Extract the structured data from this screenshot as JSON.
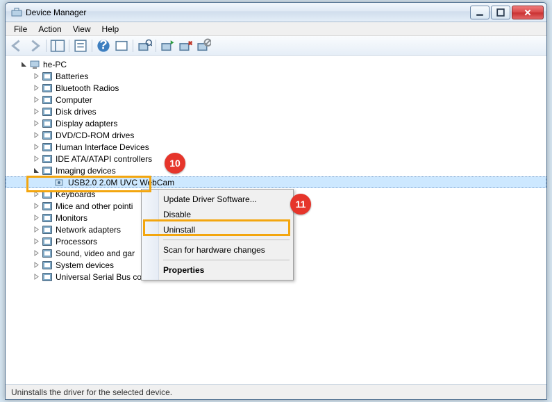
{
  "window": {
    "title": "Device Manager"
  },
  "menus": {
    "file": "File",
    "action": "Action",
    "view": "View",
    "help": "Help"
  },
  "tree": {
    "root": "he-PC",
    "categories": [
      {
        "label": "Batteries"
      },
      {
        "label": "Bluetooth Radios"
      },
      {
        "label": "Computer"
      },
      {
        "label": "Disk drives"
      },
      {
        "label": "Display adapters"
      },
      {
        "label": "DVD/CD-ROM drives"
      },
      {
        "label": "Human Interface Devices"
      },
      {
        "label": "IDE ATA/ATAPI controllers"
      },
      {
        "label": "Imaging devices",
        "expanded": true,
        "children": [
          {
            "label": "USB2.0 2.0M UVC WebCam",
            "selected": true
          }
        ]
      },
      {
        "label": "Keyboards"
      },
      {
        "label": "Mice and other pointi"
      },
      {
        "label": "Monitors"
      },
      {
        "label": "Network adapters"
      },
      {
        "label": "Processors"
      },
      {
        "label": "Sound, video and gar"
      },
      {
        "label": "System devices"
      },
      {
        "label": "Universal Serial Bus controllers"
      }
    ]
  },
  "context_menu": {
    "update": "Update Driver Software...",
    "disable": "Disable",
    "uninstall": "Uninstall",
    "scan": "Scan for hardware changes",
    "properties": "Properties"
  },
  "annotations": {
    "callout10": "10",
    "callout11": "11"
  },
  "statusbar": {
    "text": "Uninstalls the driver for the selected device."
  }
}
